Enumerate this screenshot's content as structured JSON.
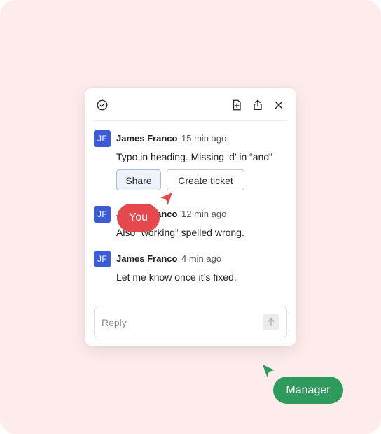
{
  "toolbar": {
    "icons": [
      "check-circle-icon",
      "add-file-icon",
      "share-icon",
      "close-icon"
    ]
  },
  "comments": [
    {
      "initials": "JF",
      "author": "James Franco",
      "time": "15 min ago",
      "text": "Typo in heading. Missing ‘d’ in “and”",
      "actions": {
        "share": "Share",
        "create_ticket": "Create ticket"
      }
    },
    {
      "initials": "JF",
      "author": "James Franco",
      "time": "12 min ago",
      "text": "Also “working” spelled wrong."
    },
    {
      "initials": "JF",
      "author": "James Franco",
      "time": "4 min ago",
      "text": "Let me know once it’s fixed."
    }
  ],
  "reply": {
    "placeholder": "Reply",
    "value": ""
  },
  "cursors": [
    {
      "label": "You",
      "color": "#e5484d"
    },
    {
      "label": "Manager",
      "color": "#2e9a5c"
    }
  ]
}
